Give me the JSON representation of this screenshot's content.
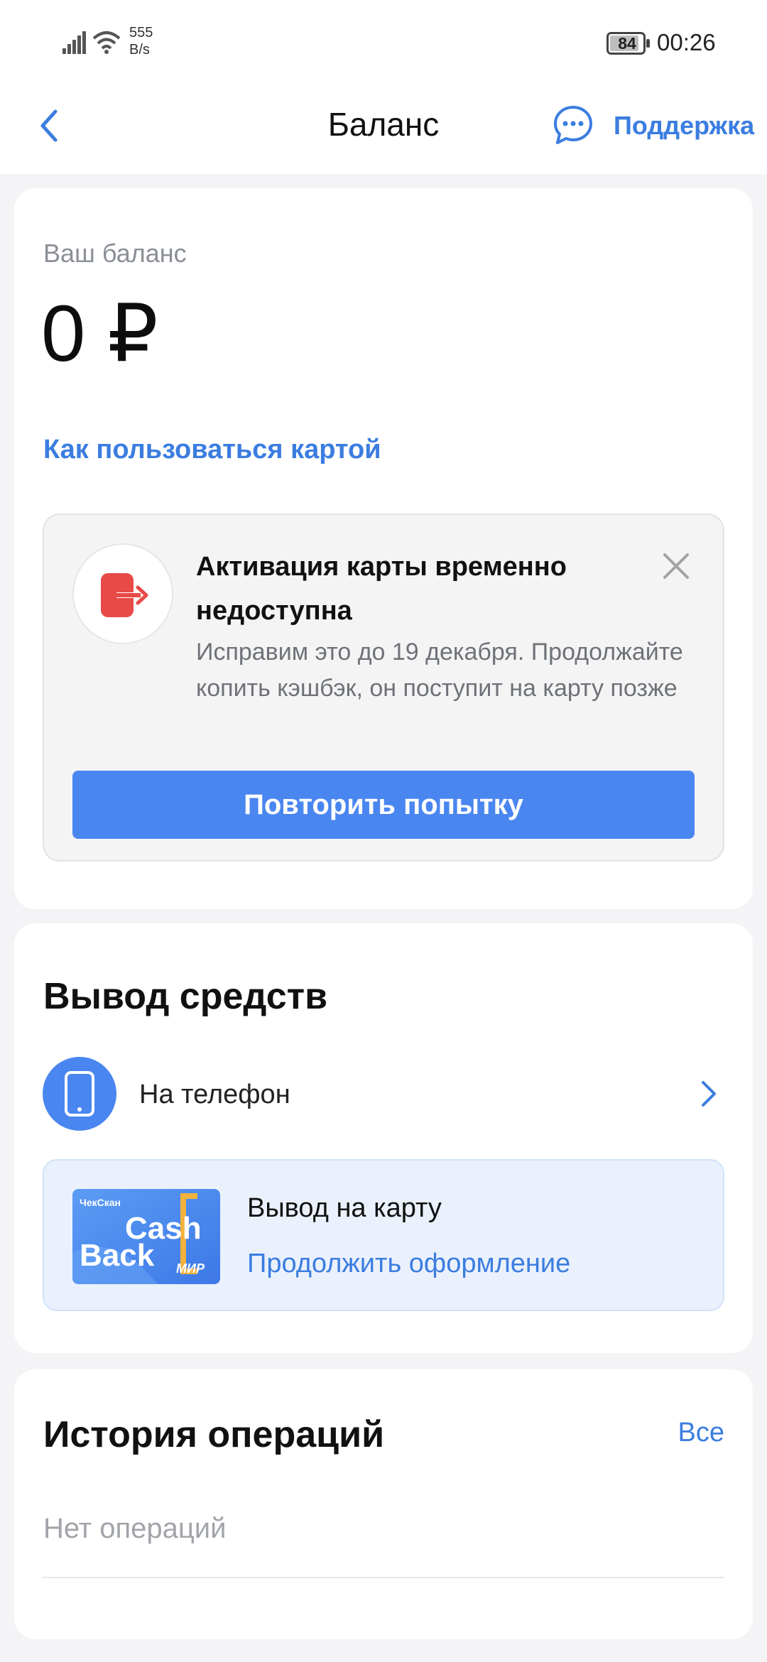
{
  "status_bar": {
    "speed_value": "555",
    "speed_unit": "B/s",
    "battery": "84",
    "time": "00:26"
  },
  "header": {
    "title": "Баланс",
    "support_label": "Поддержка"
  },
  "balance": {
    "label": "Ваш баланс",
    "value": "0 ₽",
    "howto_link": "Как пользоваться картой"
  },
  "alert": {
    "title": "Активация карты временно недоступна",
    "text": "Исправим это до 19 декабря. Продолжайте копить кэшбэк, он поступит на карту позже",
    "retry_label": "Повторить попытку"
  },
  "withdraw": {
    "title": "Вывод средств",
    "phone_label": "На телефон",
    "card_title": "Вывод на карту",
    "card_link": "Продолжить оформление",
    "card_brand_small": "ЧекСкан",
    "card_brand_word1": "Cash",
    "card_brand_word2": "Back",
    "card_network": "МИР"
  },
  "history": {
    "title": "История операций",
    "all_link": "Все",
    "empty_text": "Нет операций"
  },
  "colors": {
    "accent": "#3b7de0",
    "button": "#4a86f0",
    "alert_icon": "#e84a47"
  }
}
